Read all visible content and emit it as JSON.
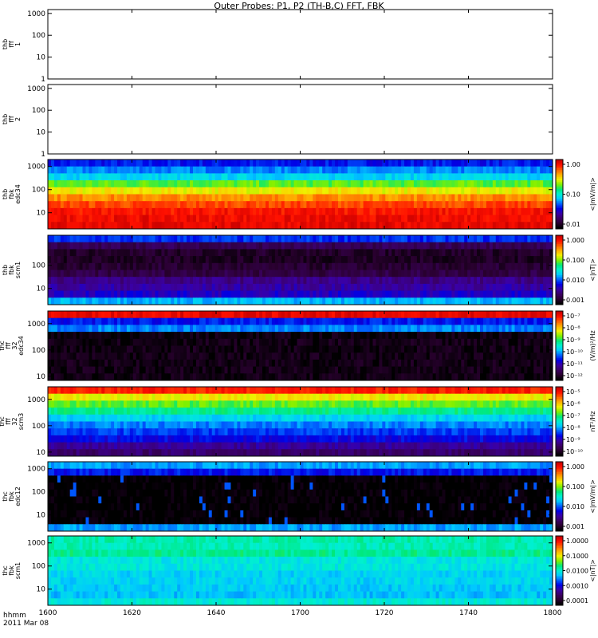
{
  "title": "Outer Probes: P1, P2 (TH-B,C) FFT, FBK",
  "footer": {
    "line1": "hhmm",
    "line2": "2011 Mar 08"
  },
  "colormap": [
    "#000000",
    "#2a0030",
    "#3a0064",
    "#3a00a6",
    "#0000e6",
    "#0060ff",
    "#00c8ff",
    "#00f0d0",
    "#00e878",
    "#80f000",
    "#f0f000",
    "#ffb000",
    "#ff6000",
    "#ff1000",
    "#c80000"
  ],
  "chart_data": {
    "type": "heatmap",
    "title": "Outer Probes: P1, P2 (TH-B,C) FFT, FBK",
    "x_ticks": [
      "1600",
      "1620",
      "1640",
      "1700",
      "1720",
      "1740",
      "1800"
    ],
    "x_range_hhmm": [
      "1600",
      "1800"
    ],
    "panels": [
      {
        "ylabel": [
          "thb",
          "fff",
          "1"
        ],
        "y_ticks": [
          "1000",
          "100",
          "10",
          "1"
        ],
        "y_range": [
          1,
          1500
        ],
        "y_scale": "log",
        "colorbar": null,
        "bands": []
      },
      {
        "ylabel": [
          "thb",
          "fff",
          "2"
        ],
        "y_ticks": [
          "1000",
          "100",
          "10",
          "1"
        ],
        "y_range": [
          1,
          1500
        ],
        "y_scale": "log",
        "colorbar": null,
        "bands": []
      },
      {
        "ylabel": [
          "thb",
          "fbk",
          "edc34"
        ],
        "y_ticks": [
          "1000",
          "100",
          "10"
        ],
        "y_range": [
          2,
          2000
        ],
        "y_scale": "log",
        "colorbar": {
          "label": "<|mV/m|>",
          "ticks": [
            "1.00",
            "0.10",
            "0.01"
          ],
          "scale": "log"
        },
        "bands": [
          0.3,
          0.38,
          0.45,
          0.62,
          0.72,
          0.82,
          0.88,
          0.93,
          0.95,
          0.96
        ]
      },
      {
        "ylabel": [
          "thb",
          "fbk",
          "scm1"
        ],
        "y_ticks": [
          "10",
          "100"
        ],
        "y_range": [
          2,
          2000
        ],
        "y_scale": "log",
        "colorbar": {
          "label": "<|nT|>",
          "ticks": [
            "1.000",
            "0.100",
            "0.010",
            "0.001"
          ],
          "scale": "log"
        },
        "bands": [
          0.32,
          0.12,
          0.06,
          0.05,
          0.07,
          0.1,
          0.18,
          0.21,
          0.25,
          0.42
        ]
      },
      {
        "ylabel": [
          "thc",
          "fff",
          "32",
          "edc34"
        ],
        "y_ticks": [
          "1000",
          "100",
          "10"
        ],
        "y_range": [
          7,
          3000
        ],
        "y_scale": "log",
        "colorbar": {
          "label": "(V/m)²/Hz",
          "ticks": [
            "10⁻⁷",
            "10⁻⁸",
            "10⁻⁹",
            "10⁻¹⁰",
            "10⁻¹¹",
            "10⁻¹²"
          ],
          "scale": "log"
        },
        "bands": [
          0.96,
          0.3,
          0.38,
          0.02,
          0.03,
          0.03,
          0.03,
          0.03,
          0.03,
          0.03
        ]
      },
      {
        "ylabel": [
          "thc",
          "fff",
          "32",
          "scm3"
        ],
        "y_ticks": [
          "10",
          "100",
          "1000"
        ],
        "y_range": [
          7,
          3000
        ],
        "y_scale": "log",
        "colorbar": {
          "label": "nT²/Hz",
          "ticks": [
            "10⁻⁵",
            "10⁻⁶",
            "10⁻⁷",
            "10⁻⁸",
            "10⁻⁹",
            "10⁻¹⁰"
          ],
          "scale": "log"
        },
        "bands": [
          0.92,
          0.72,
          0.62,
          0.55,
          0.45,
          0.38,
          0.33,
          0.28,
          0.2,
          0.15
        ]
      },
      {
        "ylabel": [
          "thc",
          "fbk",
          "edc12"
        ],
        "y_ticks": [
          "10",
          "100",
          "1000"
        ],
        "y_range": [
          2,
          2000
        ],
        "y_scale": "log",
        "colorbar": {
          "label": "<|mV/m|>",
          "ticks": [
            "1.000",
            "0.100",
            "0.010",
            "0.001"
          ],
          "scale": "log"
        },
        "bands": [
          0.4,
          0.3,
          0.0,
          0.0,
          0.0,
          0.0,
          0.0,
          0.0,
          0.0,
          0.4
        ]
      },
      {
        "ylabel": [
          "thc",
          "fbk",
          "scm1"
        ],
        "y_ticks": [
          "10",
          "100",
          "1000"
        ],
        "y_range": [
          2,
          2000
        ],
        "y_scale": "log",
        "colorbar": {
          "label": "<|nT|>",
          "ticks": [
            "1.0000",
            "0.1000",
            "0.0100",
            "0.0010",
            "0.0001"
          ],
          "scale": "log"
        },
        "bands": [
          0.53,
          0.52,
          0.55,
          0.48,
          0.48,
          0.45,
          0.45,
          0.44,
          0.43,
          0.49
        ]
      }
    ]
  }
}
